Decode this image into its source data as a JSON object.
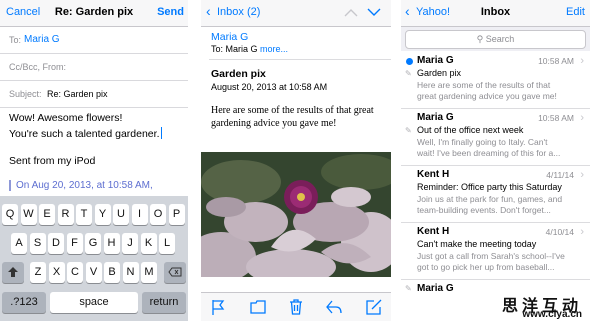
{
  "compose": {
    "cancel": "Cancel",
    "title": "Re: Garden pix",
    "send": "Send",
    "to_label": "To:",
    "to_value": "Maria G",
    "cc_label": "Cc/Bcc, From:",
    "subject_label": "Subject:",
    "subject_value": "Re: Garden pix",
    "body_line1": "Wow! Awesome flowers!",
    "body_line2": "You're such a talented gardener.",
    "signature": "Sent from my iPod",
    "quote": "On Aug 20, 2013, at 10:58 AM,",
    "keyboard": {
      "row1": [
        "Q",
        "W",
        "E",
        "R",
        "T",
        "Y",
        "U",
        "I",
        "O",
        "P"
      ],
      "row2": [
        "A",
        "S",
        "D",
        "F",
        "G",
        "H",
        "J",
        "K",
        "L"
      ],
      "row3": [
        "Z",
        "X",
        "C",
        "V",
        "B",
        "N",
        "M"
      ],
      "num_key": ".?123",
      "space_key": "space",
      "return_key": "return"
    }
  },
  "message": {
    "back": "Inbox (2)",
    "from": "Maria G",
    "to_text": "To: Maria G",
    "more": "more...",
    "subject": "Garden pix",
    "date": "August 20, 2013 at 10:58 AM",
    "body": "Here are some of the results of that great gardening advice you gave me!"
  },
  "inbox": {
    "back": "Yahoo!",
    "title": "Inbox",
    "edit": "Edit",
    "search_placeholder": "Search",
    "items": [
      {
        "from": "Maria G",
        "time": "10:58 AM",
        "subject": "Garden pix",
        "preview": "Here are some of the results of that great gardening advice you gave me!"
      },
      {
        "from": "Maria G",
        "time": "10:58 AM",
        "subject": "Out of the office next week",
        "preview": "Well, I'm finally going to Italy. Can't wait! I've been dreaming of this for a..."
      },
      {
        "from": "Kent H",
        "time": "4/11/14",
        "subject": "Reminder: Office party this Saturday",
        "preview": "Join us at the park for fun, games, and team-building events. Don't forget..."
      },
      {
        "from": "Kent H",
        "time": "4/10/14",
        "subject": "Can't make the meeting today",
        "preview": "Just got a call from Sarah's school--I've got to go pick her up from baseball..."
      },
      {
        "from": "Maria G",
        "time": "",
        "subject": "",
        "preview": ""
      }
    ]
  },
  "watermark": {
    "title": "思洋互动",
    "url": "www.ciya.cn"
  },
  "colors": {
    "accent": "#007aff",
    "unread_dot": "#007aff"
  }
}
